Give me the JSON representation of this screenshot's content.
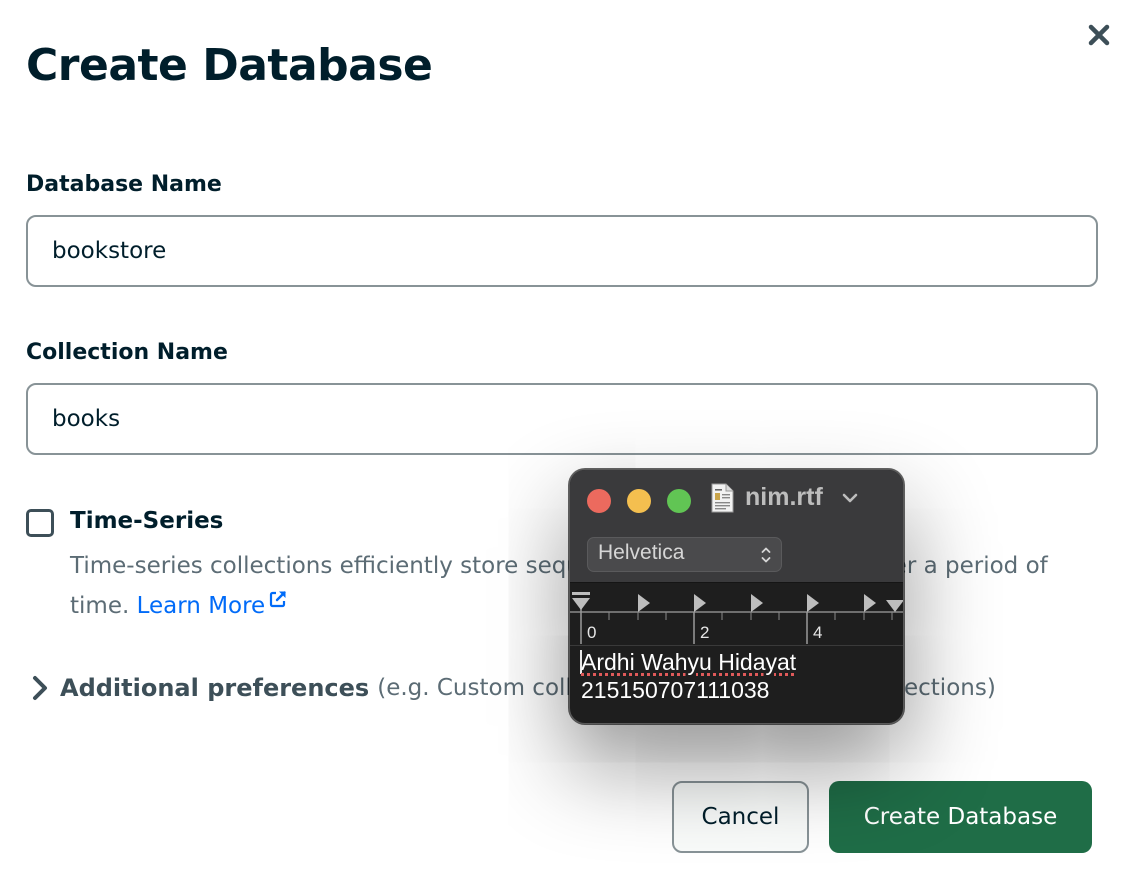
{
  "dialog": {
    "title": "Create Database",
    "close_icon": "close-icon"
  },
  "database_name": {
    "label": "Database Name",
    "value": "bookstore"
  },
  "collection_name": {
    "label": "Collection Name",
    "value": "books"
  },
  "time_series": {
    "label": "Time-Series",
    "checked": false,
    "description": "Time-series collections efficiently store sequences of measurements over a period of time.",
    "learn_more": "Learn More",
    "learn_more_icon": "external-link-icon"
  },
  "additional_preferences": {
    "icon": "chevron-right-icon",
    "title": "Additional preferences",
    "hint": "(e.g. Custom collation, Capped, Clustered collections)"
  },
  "footer": {
    "cancel_label": "Cancel",
    "create_label": "Create Database"
  },
  "textedit_window": {
    "filename": "nim.rtf",
    "font": "Helvetica",
    "ruler_labels": [
      "0",
      "2",
      "4"
    ],
    "lines": [
      "Ardhi Wahyu Hidayat",
      "215150707111038"
    ]
  },
  "colors": {
    "primary_button": "#1f6d47",
    "link": "#016bf8",
    "text_dark": "#001e2b",
    "text_muted": "#5c6c75"
  }
}
